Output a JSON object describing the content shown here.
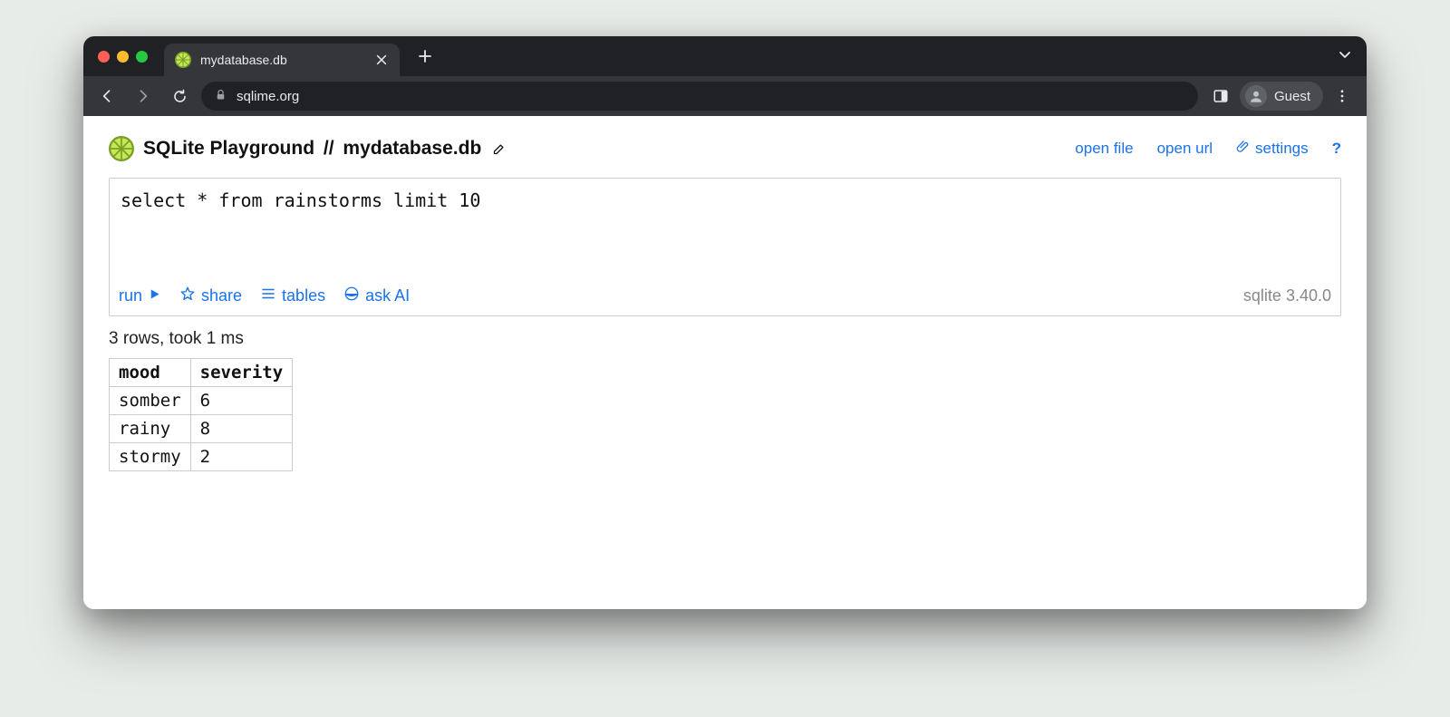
{
  "browser": {
    "tab_title": "mydatabase.db",
    "url": "sqlime.org",
    "profile_label": "Guest"
  },
  "page": {
    "app_name": "SQLite Playground",
    "separator": "//",
    "db_name": "mydatabase.db",
    "header_links": {
      "open_file": "open file",
      "open_url": "open url",
      "settings": "settings",
      "help": "?"
    }
  },
  "editor": {
    "query": "select * from rainstorms limit 10",
    "actions": {
      "run": "run",
      "share": "share",
      "tables": "tables",
      "ask_ai": "ask AI"
    },
    "version": "sqlite 3.40.0"
  },
  "results": {
    "status": "3 rows, took 1 ms",
    "headers": [
      "mood",
      "severity"
    ],
    "rows": [
      [
        "somber",
        "6"
      ],
      [
        "rainy",
        "8"
      ],
      [
        "stormy",
        "2"
      ]
    ]
  }
}
